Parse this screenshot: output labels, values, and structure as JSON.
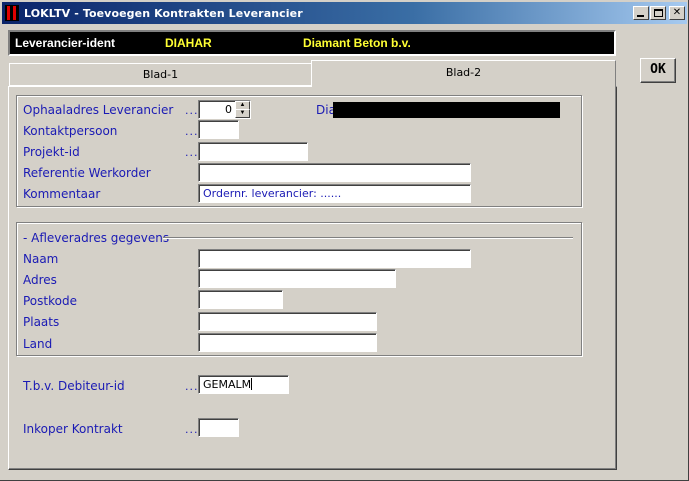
{
  "window": {
    "title": "LOKLTV - Toevoegen Kontrakten Leverancier",
    "controls": {
      "minimize": "_",
      "maximize": "□",
      "close": "✕"
    }
  },
  "header": {
    "label": "Leverancier-ident",
    "code": "DIAHAR",
    "name": "Diamant Beton b.v."
  },
  "ok_button": {
    "label": "OK"
  },
  "tabs": [
    {
      "label": "Blad-1",
      "active": false
    },
    {
      "label": "Blad-2",
      "active": true
    }
  ],
  "section1": {
    "ophaaladres": {
      "label": "Ophaaladres Leverancier",
      "dots": "...",
      "value": "0"
    },
    "dia_label": "Dia",
    "kontaktpersoon": {
      "label": "Kontaktpersoon",
      "dots": "...",
      "value": ""
    },
    "projekt": {
      "label": "Projekt-id",
      "dots": "...",
      "value": ""
    },
    "referentie": {
      "label": "Referentie Werkorder",
      "value": ""
    },
    "kommentaar": {
      "label": "Kommentaar",
      "value": "Ordernr. leverancier: ......"
    }
  },
  "section2": {
    "legend": "- Afleveradres gegevens",
    "naam": {
      "label": "Naam",
      "value": ""
    },
    "adres": {
      "label": "Adres",
      "value": ""
    },
    "postkode": {
      "label": "Postkode",
      "value": ""
    },
    "plaats": {
      "label": "Plaats",
      "value": ""
    },
    "land": {
      "label": "Land",
      "value": ""
    }
  },
  "debiteur": {
    "label": "T.b.v. Debiteur-id",
    "dots": "...",
    "value": "GEMALM"
  },
  "inkoper": {
    "label": "Inkoper Kontrakt",
    "dots": "...",
    "value": ""
  },
  "colors": {
    "label_blue": "#1a1ab4",
    "highlight_yellow": "#ffff33",
    "title_blue": "#0a246a",
    "face": "#d4d0c8"
  }
}
